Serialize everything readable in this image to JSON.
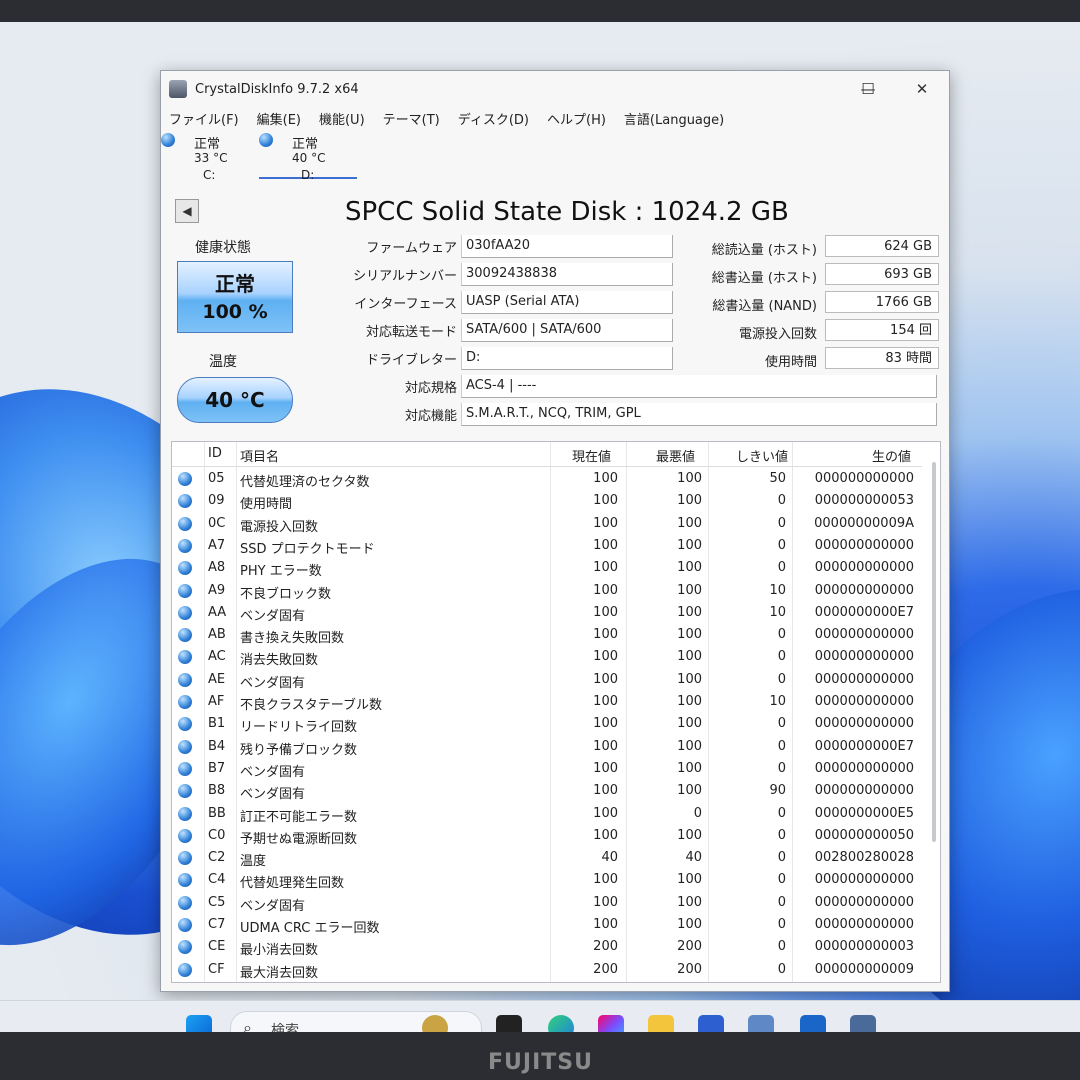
{
  "taskbar": {
    "search_placeholder": "検索",
    "brand": "FUJITSU"
  },
  "window": {
    "title": "CrystalDiskInfo 9.7.2 x64",
    "minimize": "—",
    "maximize": "☐",
    "close": "✕"
  },
  "menu": [
    "ファイル(F)",
    "編集(E)",
    "機能(U)",
    "テーマ(T)",
    "ディスク(D)",
    "ヘルプ(H)",
    "言語(Language)"
  ],
  "disk_tabs": [
    {
      "status": "正常",
      "temp": "33 °C",
      "drive": "C:"
    },
    {
      "status": "正常",
      "temp": "40 °C",
      "drive": "D:"
    }
  ],
  "disk": {
    "title": "SPCC Solid State Disk : 1024.2 GB",
    "health_label": "健康状態",
    "health_status": "正常",
    "health_percent": "100 %",
    "temp_label": "温度",
    "temp_value": "40 °C",
    "fields": [
      {
        "label": "ファームウェア",
        "value": "030fAA20"
      },
      {
        "label": "シリアルナンバー",
        "value": "30092438838"
      },
      {
        "label": "インターフェース",
        "value": "UASP (Serial ATA)"
      },
      {
        "label": "対応転送モード",
        "value": "SATA/600 | SATA/600"
      },
      {
        "label": "ドライブレター",
        "value": "D:"
      },
      {
        "label": "対応規格",
        "value": "ACS-4 | ----"
      },
      {
        "label": "対応機能",
        "value": "S.M.A.R.T., NCQ, TRIM, GPL"
      }
    ],
    "right_fields": [
      {
        "label": "総読込量 (ホスト)",
        "value": "624 GB"
      },
      {
        "label": "総書込量 (ホスト)",
        "value": "693 GB"
      },
      {
        "label": "総書込量 (NAND)",
        "value": "1766 GB"
      },
      {
        "label": "電源投入回数",
        "value": "154 回"
      },
      {
        "label": "使用時間",
        "value": "83 時間"
      }
    ]
  },
  "smart": {
    "headers": {
      "id": "ID",
      "name": "項目名",
      "current": "現在値",
      "worst": "最悪値",
      "threshold": "しきい値",
      "raw": "生の値"
    },
    "rows": [
      {
        "id": "05",
        "name": "代替処理済のセクタ数",
        "current": "100",
        "worst": "100",
        "threshold": "50",
        "raw": "000000000000"
      },
      {
        "id": "09",
        "name": "使用時間",
        "current": "100",
        "worst": "100",
        "threshold": "0",
        "raw": "000000000053"
      },
      {
        "id": "0C",
        "name": "電源投入回数",
        "current": "100",
        "worst": "100",
        "threshold": "0",
        "raw": "00000000009A"
      },
      {
        "id": "A7",
        "name": "SSD プロテクトモード",
        "current": "100",
        "worst": "100",
        "threshold": "0",
        "raw": "000000000000"
      },
      {
        "id": "A8",
        "name": "PHY エラー数",
        "current": "100",
        "worst": "100",
        "threshold": "0",
        "raw": "000000000000"
      },
      {
        "id": "A9",
        "name": "不良ブロック数",
        "current": "100",
        "worst": "100",
        "threshold": "10",
        "raw": "000000000000"
      },
      {
        "id": "AA",
        "name": "ベンダ固有",
        "current": "100",
        "worst": "100",
        "threshold": "10",
        "raw": "0000000000E7"
      },
      {
        "id": "AB",
        "name": "書き換え失敗回数",
        "current": "100",
        "worst": "100",
        "threshold": "0",
        "raw": "000000000000"
      },
      {
        "id": "AC",
        "name": "消去失敗回数",
        "current": "100",
        "worst": "100",
        "threshold": "0",
        "raw": "000000000000"
      },
      {
        "id": "AE",
        "name": "ベンダ固有",
        "current": "100",
        "worst": "100",
        "threshold": "0",
        "raw": "000000000000"
      },
      {
        "id": "AF",
        "name": "不良クラスタテーブル数",
        "current": "100",
        "worst": "100",
        "threshold": "10",
        "raw": "000000000000"
      },
      {
        "id": "B1",
        "name": "リードリトライ回数",
        "current": "100",
        "worst": "100",
        "threshold": "0",
        "raw": "000000000000"
      },
      {
        "id": "B4",
        "name": "残り予備ブロック数",
        "current": "100",
        "worst": "100",
        "threshold": "0",
        "raw": "0000000000E7"
      },
      {
        "id": "B7",
        "name": "ベンダ固有",
        "current": "100",
        "worst": "100",
        "threshold": "0",
        "raw": "000000000000"
      },
      {
        "id": "B8",
        "name": "ベンダ固有",
        "current": "100",
        "worst": "100",
        "threshold": "90",
        "raw": "000000000000"
      },
      {
        "id": "BB",
        "name": "訂正不可能エラー数",
        "current": "100",
        "worst": "0",
        "threshold": "0",
        "raw": "0000000000E5"
      },
      {
        "id": "C0",
        "name": "予期せぬ電源断回数",
        "current": "100",
        "worst": "100",
        "threshold": "0",
        "raw": "000000000050"
      },
      {
        "id": "C2",
        "name": "温度",
        "current": "40",
        "worst": "40",
        "threshold": "0",
        "raw": "002800280028"
      },
      {
        "id": "C4",
        "name": "代替処理発生回数",
        "current": "100",
        "worst": "100",
        "threshold": "0",
        "raw": "000000000000"
      },
      {
        "id": "C5",
        "name": "ベンダ固有",
        "current": "100",
        "worst": "100",
        "threshold": "0",
        "raw": "000000000000"
      },
      {
        "id": "C7",
        "name": "UDMA CRC エラー回数",
        "current": "100",
        "worst": "100",
        "threshold": "0",
        "raw": "000000000000"
      },
      {
        "id": "CE",
        "name": "最小消去回数",
        "current": "200",
        "worst": "200",
        "threshold": "0",
        "raw": "000000000003"
      },
      {
        "id": "CF",
        "name": "最大消去回数",
        "current": "200",
        "worst": "200",
        "threshold": "0",
        "raw": "000000000009"
      }
    ]
  }
}
